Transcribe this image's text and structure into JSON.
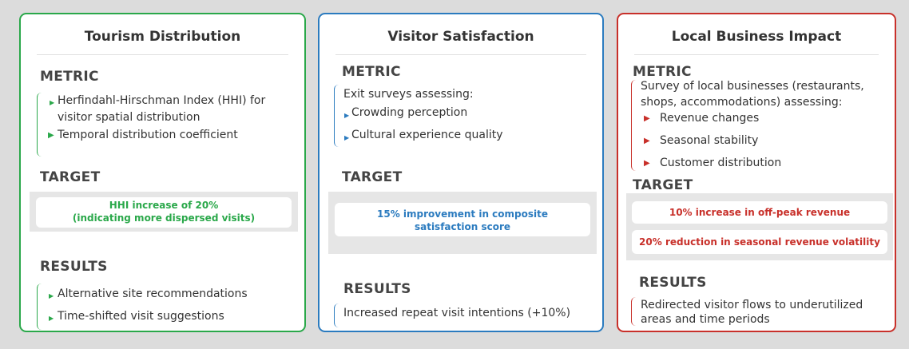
{
  "colors": {
    "green": "#2aa84a",
    "blue": "#2b7bbf",
    "red": "#c8302a",
    "text": "#333333",
    "band": "#dcdcdc"
  },
  "panels": [
    {
      "title": "Tourism Distribution",
      "metric_label": "METRIC",
      "metric_items": [
        "Herfindahl-Hirschman Index (HHI) for",
        "visitor spatial distribution",
        "Temporal distribution coefficient"
      ],
      "target_label": "TARGET",
      "targets": [
        [
          "HHI increase of 20%",
          "(indicating more dispersed visits)"
        ]
      ],
      "results_label": "RESULTS",
      "results_items": [
        "Alternative site recommendations",
        "Time-shifted visit suggestions"
      ]
    },
    {
      "title": "Visitor Satisfaction",
      "metric_label": "METRIC",
      "metric_intro": "Exit surveys assessing:",
      "metric_items": [
        "Crowding perception",
        "Cultural experience quality"
      ],
      "target_label": "TARGET",
      "targets": [
        [
          "15% improvement in composite",
          "satisfaction score"
        ]
      ],
      "results_label": "RESULTS",
      "results_items": [
        "Increased repeat visit intentions (+10%)"
      ]
    },
    {
      "title": "Local Business Impact",
      "metric_label": "METRIC",
      "metric_intro_lines": [
        "Survey of local businesses (restaurants,",
        "shops, accommodations) assessing:"
      ],
      "metric_items": [
        "Revenue changes",
        "Seasonal stability",
        "Customer distribution"
      ],
      "target_label": "TARGET",
      "targets": [
        [
          "10% increase in off-peak revenue"
        ],
        [
          "20% reduction in seasonal revenue volatility"
        ]
      ],
      "results_label": "RESULTS",
      "results_lines": [
        "Redirected visitor flows to underutilized",
        "areas and time periods"
      ]
    }
  ]
}
